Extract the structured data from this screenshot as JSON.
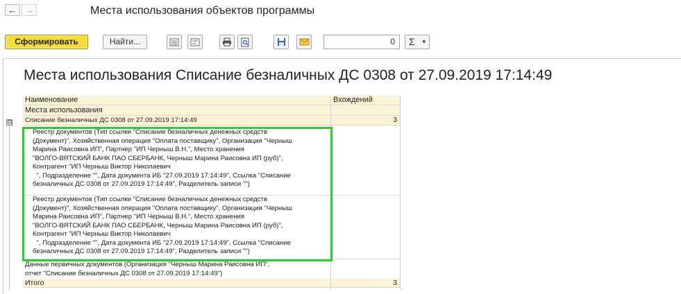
{
  "window": {
    "back_icon": "←",
    "forward_icon": "→",
    "title": "Места использования объектов программы"
  },
  "toolbar": {
    "generate_label": "Сформировать",
    "find_label": "Найти...",
    "number_value": "0",
    "sum_label": "Σ",
    "sum_dropdown_icon": "▾",
    "icons": [
      "expand-groups-icon",
      "collapse-groups-icon",
      "print-icon",
      "preview-icon",
      "save-icon",
      "mail-icon"
    ]
  },
  "report": {
    "title": "Места использования Списание безналичных ДС 0308 от 27.09.2019 17:14:49",
    "columns": {
      "name": "Наименование",
      "count": "Вхождений",
      "subheader": "Места использования"
    },
    "group": {
      "toggle": "⊟",
      "name": "Списание безналичных ДС 0308 от 27.09.2019 17:14:49",
      "count": "3"
    },
    "rows": [
      {
        "text": "Реестр документов (Тип ссылки \"Списание безналичных денежных средств\n(Документ)\", Хозяйственная операция \"Оплата поставщику\", Организация \"Черныш\nМарина Раисовна ИП\", Партнер \"ИП Черныш В.Н.\", Место хранения\n\"ВОЛГО-ВЯТСКИЙ БАНК ПАО СБЕРБАНК, Черныш Марина Раисовна ИП (руб)\",\nКонтрагент \"ИП Черныш Виктор Николаевич\n  \", Подразделение \"\", Дата документа ИБ \"27.09.2019 17:14:49\", Ссылка \"Списание\nбезналичных ДС 0308 от 27.09.2019 17:14:49\", Разделитель записи \"\")"
      },
      {
        "text": "Реестр документов (Тип ссылки \"Списание безналичных денежных средств\n(Документ)\", Хозяйственная операция \"Оплата поставщику\", Организация \"Черныш\nМарина Раисовна ИП\", Партнер \"ИП Черныш В.Н.\", Место хранения\n\"ВОЛГО-ВЯТСКИЙ БАНК ПАО СБЕРБАНК, Черныш Марина Раисовна ИП (руб)\",\nКонтрагент \"ИП Черныш Виктор Николаевич\n  \", Подразделение \"\", Дата документа ИБ \"27.09.2019 17:14:49\", Ссылка \"Списание\nбезналичных ДС 0308 от 27.09.2019 17:14:49\", Разделитель записи \"\")"
      },
      {
        "text": "Данные первичных документов (Организация \"Черныш Марина Раисовна ИП\",\nотчет \"Списание безналичных ДС 0308 от 27.09.2019 17:14:49\")"
      }
    ],
    "total": {
      "label": "Итого",
      "count": "3"
    }
  }
}
